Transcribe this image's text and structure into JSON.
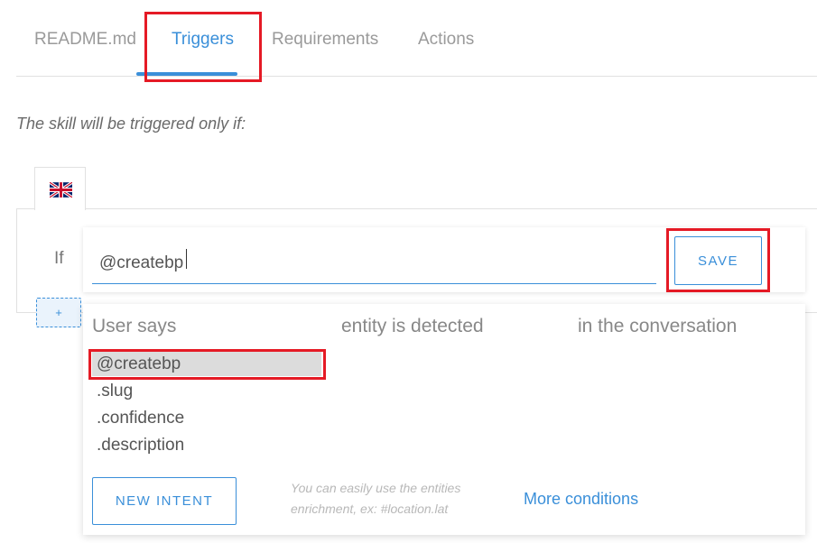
{
  "tabs": [
    {
      "label": "README.md"
    },
    {
      "label": "Triggers"
    },
    {
      "label": "Requirements"
    },
    {
      "label": "Actions"
    }
  ],
  "intro": "The skill will be triggered only if:",
  "language": {
    "icon": "uk-flag-icon"
  },
  "condition": {
    "if_label": "If",
    "input_value": "@createbp",
    "save_label": "SAVE",
    "add_label": "+"
  },
  "dropdown": {
    "headers": [
      "User says",
      "entity is detected",
      "in the conversation"
    ],
    "options": [
      "@createbp",
      ".slug",
      ".confidence",
      ".description"
    ],
    "new_intent_label": "NEW INTENT",
    "hint": "You can easily use the entities enrichment, ex: #location.lat",
    "more_label": "More conditions"
  },
  "colors": {
    "accent": "#3a8fd9",
    "highlight": "#e51a25",
    "selected_bg": "#dcdcdc"
  }
}
